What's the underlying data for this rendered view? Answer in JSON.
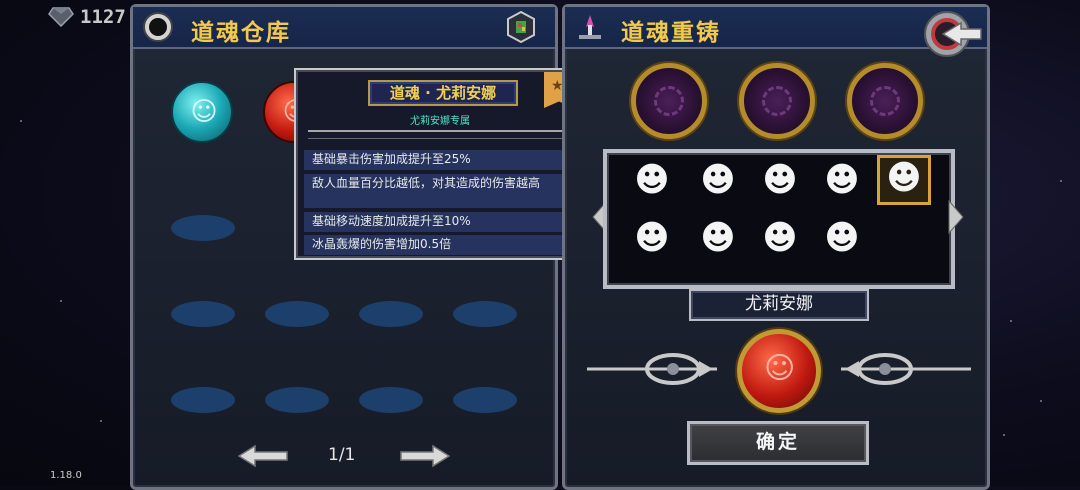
{
  "currency": {
    "gems": "1127",
    "gem_icon": "gem-icon"
  },
  "version": "1.18.0",
  "storage_panel": {
    "title": "道魂仓库",
    "page_indicator": "1/1",
    "souls": [
      {
        "color": "#1aa8b5",
        "icon": "blue-soul-orb"
      },
      {
        "color": "#c0190f",
        "icon": "red-soul-orb"
      }
    ]
  },
  "tooltip": {
    "title": "道魂 · 尤莉安娜",
    "subtitle": "尤莉安娜专属",
    "lines": [
      "基础暴击伤害加成提升至25%",
      "敌人血量百分比越低，对其造成的伤害越高",
      "基础移动速度加成提升至10%",
      "冰晶轰爆的伤害增加0.5倍"
    ]
  },
  "reforge_panel": {
    "title": "道魂重铸",
    "selected_character": "尤莉安娜",
    "confirm_label": "确定",
    "character_count": 9,
    "selected_index": 4
  },
  "colors": {
    "title_gold": "#f2c94c",
    "panel_header": "#1b2d52",
    "slot_blue": "#1d3f6b",
    "tooltip_cyan": "#52e6c9"
  }
}
